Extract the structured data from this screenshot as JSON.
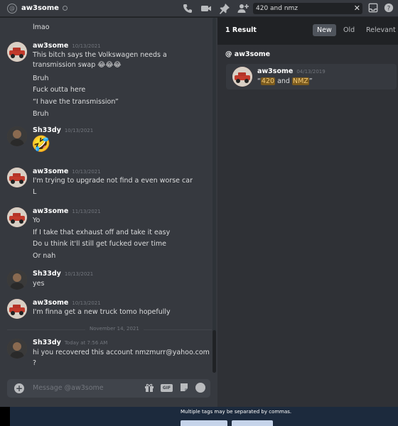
{
  "header": {
    "channel_name": "aw3some",
    "search_value": "420 and nmz",
    "icons": [
      "at-icon",
      "status-icon",
      "phone-icon",
      "video-icon",
      "pin-icon",
      "add-member-icon",
      "close-icon",
      "inbox-icon",
      "help-icon"
    ]
  },
  "messages": {
    "m0": {
      "lines": [
        "lmao"
      ]
    },
    "m1": {
      "author": "aw3some",
      "time": "10/13/2021",
      "lines": [
        "This bitch says the Volkswagen needs a",
        "transmission swap 😂😂😂",
        "Bruh",
        "Fuck outta here",
        "“I have the transmission”",
        "Bruh"
      ]
    },
    "m2": {
      "author": "Sh33dy",
      "time": "10/13/2021",
      "emoji": "🤣"
    },
    "m3": {
      "author": "aw3some",
      "time": "10/13/2021",
      "lines": [
        "I'm trying to upgrade not find a even worse car",
        "L"
      ]
    },
    "m4": {
      "author": "aw3some",
      "time": "11/13/2021",
      "lines": [
        "Yo",
        "If I take that exhaust off and take it easy",
        "Do u think it'll still get fucked over time",
        "Or nah"
      ]
    },
    "m5": {
      "author": "Sh33dy",
      "time": "10/13/2021",
      "lines": [
        "yes"
      ]
    },
    "m6": {
      "author": "aw3some",
      "time": "10/13/2021",
      "lines": [
        "I'm finna get a new truck tomo hopefully"
      ]
    },
    "divider": "November 14, 2021",
    "m7": {
      "author": "Sh33dy",
      "time": "Today at 7:56 AM",
      "lines": [
        "hi you recovered this account nmzmurr@yahoo.com",
        "?"
      ]
    }
  },
  "composer": {
    "placeholder": "Message @aw3some",
    "gif_label": "GIF"
  },
  "results": {
    "count": "1 Result",
    "tabs": [
      "New",
      "Old",
      "Relevant"
    ],
    "active_tab": "New",
    "channel": "@ aw3some",
    "card": {
      "author": "aw3some",
      "time": "04/13/2019",
      "quote_open": "“",
      "hl1": "420",
      "mid": " and ",
      "hl2": "NMZ",
      "quote_close": "”"
    }
  },
  "bottom": {
    "hint": "Multiple tags may be separated by commas."
  },
  "colors": {
    "chat_bg": "#36393f",
    "sidebar_bg": "#2f3136",
    "header_bg": "#202225",
    "highlight": "#7a5a1e"
  }
}
